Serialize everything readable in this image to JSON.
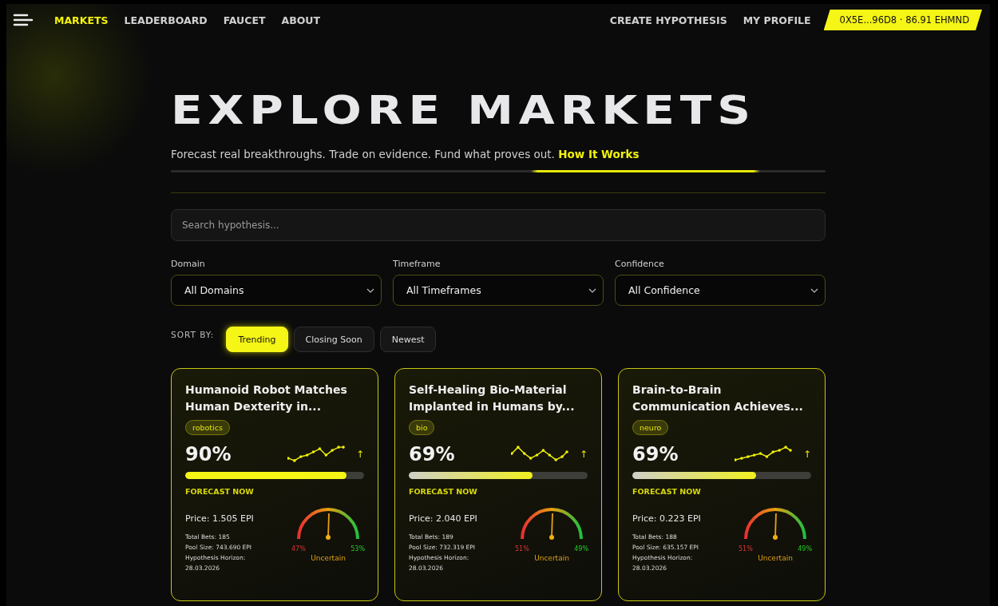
{
  "nav": {
    "left": [
      {
        "label": "MARKETS",
        "selected": true
      },
      {
        "label": "LEADERBOARD",
        "selected": false
      },
      {
        "label": "FAUCET",
        "selected": false
      },
      {
        "label": "ABOUT",
        "selected": false
      }
    ],
    "right": [
      "CREATE HYPOTHESIS",
      "MY PROFILE"
    ],
    "wallet": "0X5E...96D8 · 86.91 EHMND"
  },
  "hero": {
    "title": "EXPLORE MARKETS",
    "subtitle": "Forecast real breakthroughs. Trade on evidence. Fund what proves out.",
    "link": "How It Works"
  },
  "search": {
    "placeholder": "Search hypothesis..."
  },
  "filters": [
    {
      "label": "Domain",
      "value": "All Domains"
    },
    {
      "label": "Timeframe",
      "value": "All Timeframes"
    },
    {
      "label": "Confidence",
      "value": "All Confidence"
    }
  ],
  "sort": {
    "label": "SORT BY:",
    "options": [
      {
        "label": "Trending",
        "selected": true
      },
      {
        "label": "Closing Soon",
        "selected": false
      },
      {
        "label": "Newest",
        "selected": false
      }
    ]
  },
  "cards": [
    {
      "title": "Humanoid Robot Matches Human Dexterity in...",
      "tag": "robotics",
      "percent": "90%",
      "trend": "↑",
      "level": 0.9,
      "cta": "FORECAST NOW",
      "price": "Price: 1.505 EPI",
      "total_bets": "Total Bets: 185",
      "pool_size": "Pool Size: 743.690 EPI",
      "horizon_label": "Hypothesis Horizon:",
      "horizon_date": "28.03.2026",
      "gauge_low": "47%",
      "gauge_high": "53%",
      "gauge_status": "Uncertain"
    },
    {
      "title": "Self-Healing Bio-Material Implanted in Humans by...",
      "tag": "bio",
      "percent": "69%",
      "trend": "↑",
      "level": 0.69,
      "cta": "FORECAST NOW",
      "price": "Price: 2.040 EPI",
      "total_bets": "Total Bets: 189",
      "pool_size": "Pool Size: 732.319 EPI",
      "horizon_label": "Hypothesis Horizon:",
      "horizon_date": "28.03.2026",
      "gauge_low": "51%",
      "gauge_high": "49%",
      "gauge_status": "Uncertain"
    },
    {
      "title": "Brain-to-Brain Communication Achieves...",
      "tag": "neuro",
      "percent": "69%",
      "trend": "↑",
      "level": 0.69,
      "cta": "FORECAST NOW",
      "price": "Price: 0.223 EPI",
      "total_bets": "Total Bets: 188",
      "pool_size": "Pool Size: 635.157 EPI",
      "horizon_label": "Hypothesis Horizon:",
      "horizon_date": "28.03.2026",
      "gauge_low": "51%",
      "gauge_high": "49%",
      "gauge_status": "Uncertain"
    }
  ]
}
